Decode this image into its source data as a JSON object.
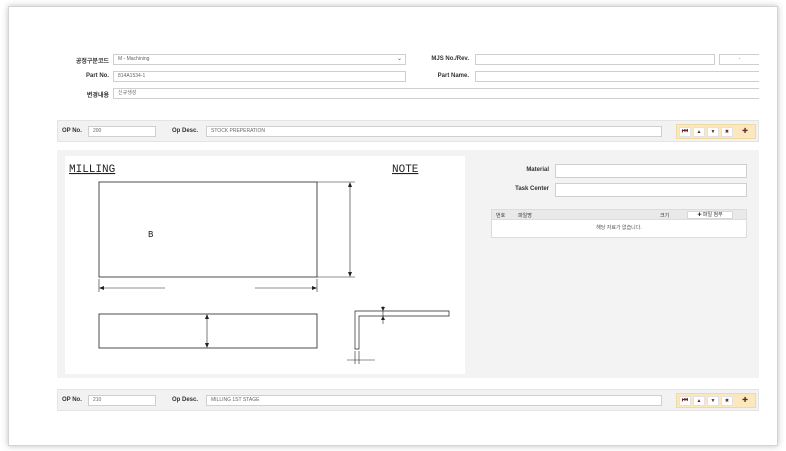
{
  "header": {
    "process_code_label": "공정구분코드",
    "process_code_value": "M - Machining",
    "part_no_label": "Part No.",
    "part_no_value": "814A1534-1",
    "change_label": "변경내용",
    "change_value": "신규생성",
    "mjs_label": "MJS No./Rev.",
    "mjs_value": "",
    "rev_value": "-",
    "part_name_label": "Part Name.",
    "part_name_value": ""
  },
  "op1": {
    "op_no_label": "OP No.",
    "op_no_value": "200",
    "op_desc_label": "Op Desc.",
    "op_desc_value": "STOCK PREPERATION"
  },
  "op2": {
    "op_no_label": "OP No.",
    "op_no_value": "210",
    "op_desc_label": "Op Desc.",
    "op_desc_value": "MILLING 1ST STAGE"
  },
  "nav": {
    "first": "⏮",
    "up": "▲",
    "down": "▼",
    "delete": "✖",
    "add": "✚"
  },
  "drawing": {
    "title": "MILLING",
    "note": "NOTE",
    "dim_b": "B"
  },
  "details": {
    "material_label": "Material",
    "task_center_label": "Task Center",
    "col_no": "번호",
    "col_file": "파일명",
    "col_size": "크기",
    "attach_label": "✚ 파일 첨부",
    "empty_text": "해당 자료가 없습니다."
  },
  "colors": {
    "accent": "#fbe8bf",
    "nav_icon": "#6a2424"
  }
}
